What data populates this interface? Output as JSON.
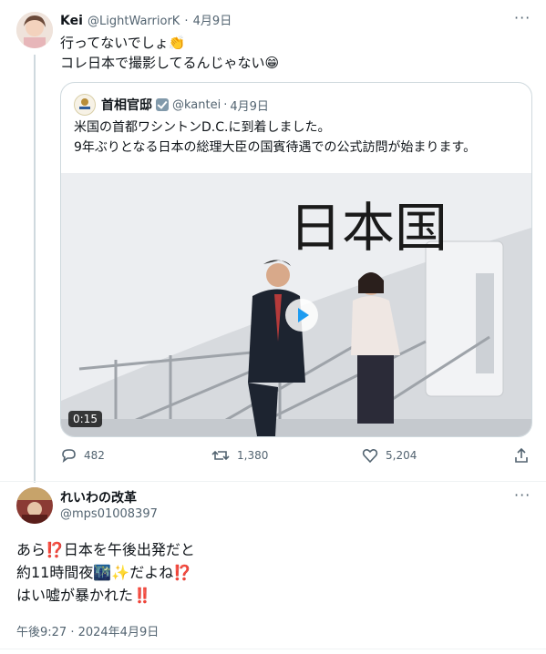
{
  "tweet": {
    "name": "Kei",
    "handle": "@LightWarriorK",
    "date": "4月9日",
    "lines": [
      "行ってないでしょ👏",
      "コレ日本で撮影してるんじゃない😁"
    ]
  },
  "quote": {
    "name": "首相官邸",
    "handle": "@kantei",
    "date": "4月9日",
    "lines": [
      "米国の首都ワシントンD.C.に到着しました。",
      "9年ぶりとなる日本の総理大臣の国賓待遇での公式訪問が始まります。"
    ],
    "video": {
      "duration": "0:15",
      "plane_text": "日本国"
    }
  },
  "actions": {
    "replies": "482",
    "retweets": "1,380",
    "likes": "5,204"
  },
  "reply": {
    "name": "れいわの改革",
    "handle": "@mps01008397",
    "lines": [
      "あら⁉️日本を午後出発だと",
      "約11時間夜🌃✨だよね⁉️",
      "はい嘘が暴かれた‼️"
    ],
    "timestamp": "午後9:27 · 2024年4月9日"
  },
  "more_glyph": "···",
  "icons": {
    "reply": "reply-icon",
    "retweet": "retweet-icon",
    "like": "heart-icon",
    "share": "share-icon",
    "more": "more-icon",
    "verified": "verified-badge-icon"
  }
}
